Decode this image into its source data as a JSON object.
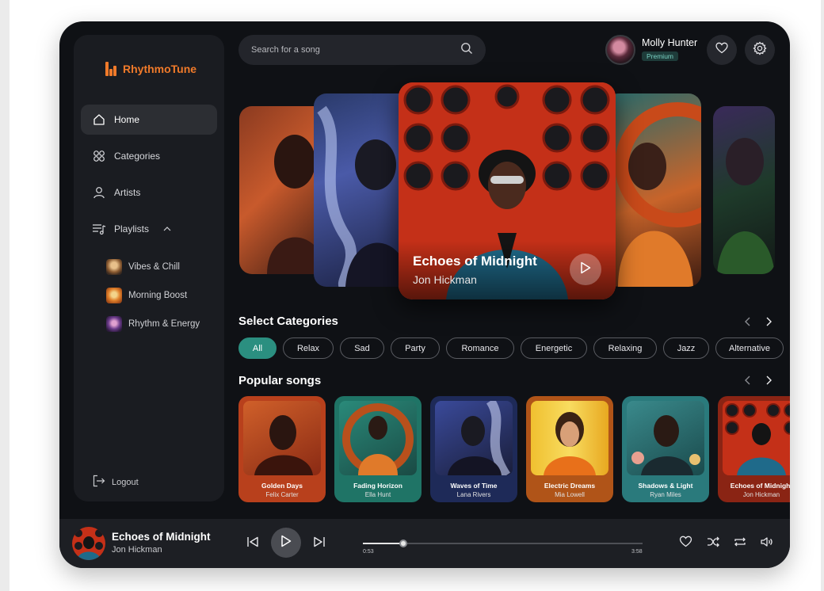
{
  "brand": {
    "name": "RhythmoTune",
    "accent": "#f07a2a"
  },
  "nav": {
    "items": [
      {
        "label": "Home",
        "icon": "home-icon",
        "active": true
      },
      {
        "label": "Categories",
        "icon": "grid-icon",
        "active": false
      },
      {
        "label": "Artists",
        "icon": "user-icon",
        "active": false
      },
      {
        "label": "Playlists",
        "icon": "playlist-icon",
        "active": false
      }
    ],
    "playlists": [
      {
        "label": "Vibes & Chill"
      },
      {
        "label": "Morning Boost"
      },
      {
        "label": "Rhythm & Energy"
      }
    ],
    "logout": "Logout"
  },
  "search": {
    "placeholder": "Search for a song"
  },
  "user": {
    "name": "Molly Hunter",
    "badge": "Premium"
  },
  "hero": {
    "title": "Echoes of Midnight",
    "artist": "Jon Hickman"
  },
  "categories": {
    "title": "Select Categories",
    "items": [
      "All",
      "Relax",
      "Sad",
      "Party",
      "Romance",
      "Energetic",
      "Relaxing",
      "Jazz",
      "Alternative"
    ],
    "active": "All",
    "accent": "#2b8f80"
  },
  "popular": {
    "title": "Popular songs",
    "songs": [
      {
        "title": "Golden Days",
        "artist": "Felix Carter"
      },
      {
        "title": "Fading Horizon",
        "artist": "Ella Hunt"
      },
      {
        "title": "Waves of Time",
        "artist": "Lana Rivers"
      },
      {
        "title": "Electric Dreams",
        "artist": "Mia Lowell"
      },
      {
        "title": "Shadows & Light",
        "artist": "Ryan Miles"
      },
      {
        "title": "Echoes of Midnight",
        "artist": "Jon Hickman"
      }
    ]
  },
  "player": {
    "title": "Echoes of Midnight",
    "artist": "Jon Hickman",
    "elapsed": "0:53",
    "duration": "3:58",
    "progress": 0.145
  }
}
